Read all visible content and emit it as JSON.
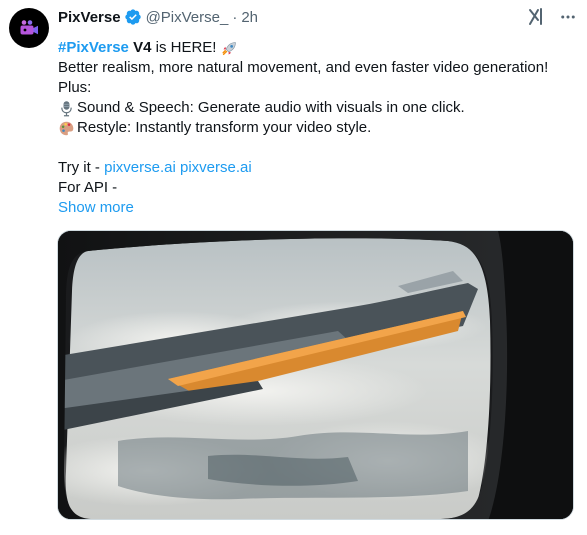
{
  "tweet": {
    "author_name": "PixVerse",
    "handle": "@PixVerse_",
    "separator": "·",
    "time": "2h",
    "verified": true,
    "accent_color": "#1d9bf0",
    "hashtag": "#PixVerse",
    "version": "V4",
    "headline_rest": "is HERE!",
    "line2": "Better realism, more natural movement, and even faster video generation!",
    "line3": "Plus:",
    "line4": "Sound & Speech: Generate audio with visuals in one click.",
    "line5": "Restyle: Instantly transform your video style.",
    "try_prefix": "Try it - ",
    "link1": "pixverse.ai",
    "link2": "pixverse.ai",
    "api_line": "For API -",
    "show_more": "Show more",
    "icons": {
      "avatar": "pixverse-logo-icon",
      "rocket": "rocket-icon",
      "microphone": "microphone-icon",
      "palette": "palette-icon",
      "grok": "grok-icon",
      "more": "more-options-icon"
    }
  }
}
